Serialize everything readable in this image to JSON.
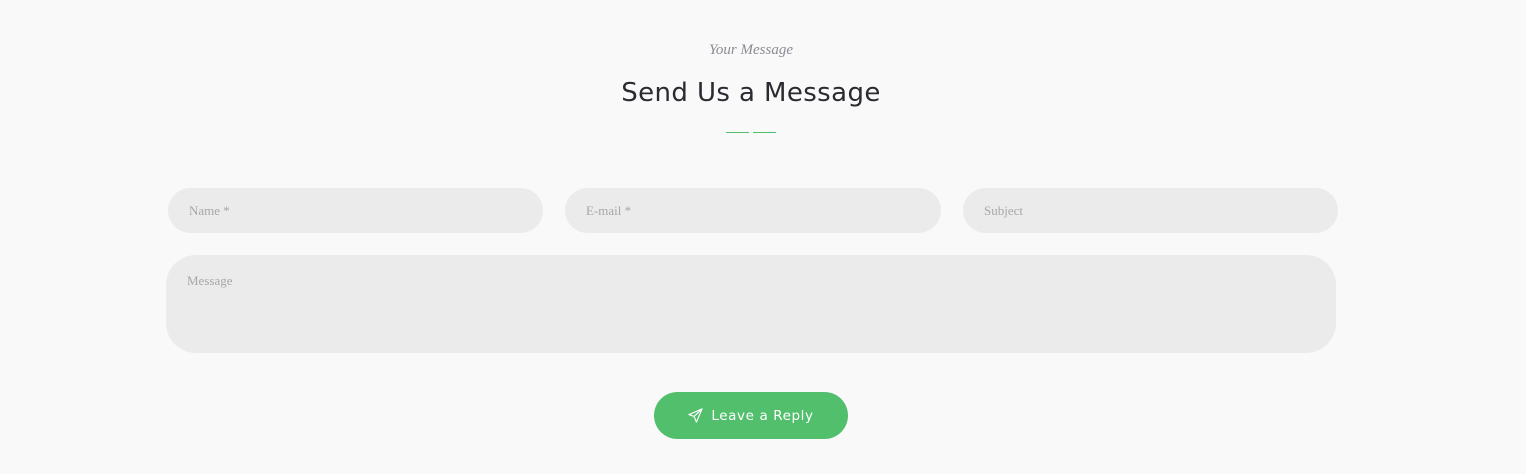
{
  "section": {
    "eyebrow": "Your Message",
    "title": "Send Us a Message"
  },
  "form": {
    "name_placeholder": "Name *",
    "email_placeholder": "E-mail *",
    "subject_placeholder": "Subject",
    "message_placeholder": "Message",
    "submit_label": "Leave a Reply",
    "submit_icon": "paper-plane-icon"
  },
  "colors": {
    "accent": "#52bf6d",
    "background": "#f9f9f9",
    "field_background": "#ebebeb",
    "title": "#2b2a31",
    "eyebrow": "#8d8a93"
  }
}
